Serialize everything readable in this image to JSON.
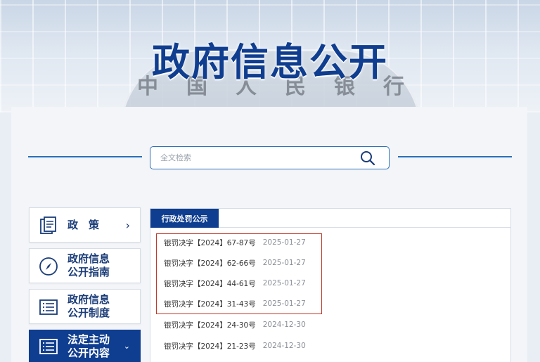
{
  "banner": {
    "title": "政府信息公开",
    "facade_chars": [
      "中",
      "国",
      "人",
      "民",
      "银",
      "行"
    ]
  },
  "search": {
    "placeholder": "全文检索"
  },
  "sidebar": {
    "items": [
      {
        "label": "政　策",
        "icon": "document-stack-icon",
        "arrow": "›"
      },
      {
        "label": "政府信息\n公开指南",
        "icon": "compass-icon"
      },
      {
        "label": "政府信息\n公开制度",
        "icon": "list-icon"
      },
      {
        "label": "法定主动\n公开内容",
        "icon": "list-icon",
        "arrow": "⌄",
        "active": true
      }
    ]
  },
  "list": {
    "tab_label": "行政处罚公示",
    "rows": [
      {
        "doc": "银罚决字【2024】67-87号",
        "date": "2025-01-27"
      },
      {
        "doc": "银罚决字【2024】62-66号",
        "date": "2025-01-27"
      },
      {
        "doc": "银罚决字【2024】44-61号",
        "date": "2025-01-27"
      },
      {
        "doc": "银罚决字【2024】31-43号",
        "date": "2025-01-27"
      },
      {
        "doc": "银罚决字【2024】24-30号",
        "date": "2024-12-30"
      },
      {
        "doc": "银罚决字【2024】21-23号",
        "date": "2024-12-30"
      }
    ]
  },
  "colors": {
    "brand_blue": "#0f3d8f",
    "accent_blue": "#2f70b8",
    "highlight_red": "#c0392b"
  }
}
